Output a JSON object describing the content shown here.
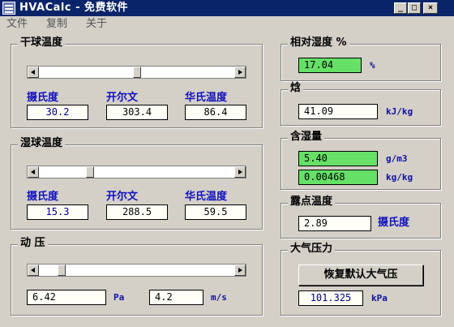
{
  "window": {
    "title": "HVACalc - 免费软件",
    "minimize": "_",
    "maximize": "□",
    "close": "×"
  },
  "menu": {
    "file": "文件",
    "copy": "复制",
    "about": "关于"
  },
  "dry_bulb": {
    "title": "干球温度",
    "celsius_label": "摄氏度",
    "kelvin_label": "开尔文",
    "fahrenheit_label": "华氏温度",
    "celsius": "30.2",
    "kelvin": "303.4",
    "fahrenheit": "86.4",
    "slider_fraction": 0.5
  },
  "wet_bulb": {
    "title": "湿球温度",
    "celsius_label": "摄氏度",
    "kelvin_label": "开尔文",
    "fahrenheit_label": "华氏温度",
    "celsius": "15.3",
    "kelvin": "288.5",
    "fahrenheit": "59.5",
    "slider_fraction": 0.25
  },
  "dynamic_pressure": {
    "title": "动 压",
    "pressure": "6.42",
    "pressure_unit": "Pa",
    "velocity": "4.2",
    "velocity_unit": "m/s",
    "slider_fraction": 0.1
  },
  "relative_humidity": {
    "title": "相对湿度 %",
    "value": "17.04",
    "unit": "%"
  },
  "enthalpy": {
    "title": "焓",
    "value": "41.09",
    "unit": "kJ/kg"
  },
  "moisture": {
    "title": "含湿量",
    "value1": "5.40",
    "unit1": "g/m3",
    "value2": "0.00468",
    "unit2": "kg/kg"
  },
  "dew_point": {
    "title": "露点温度",
    "value": "2.89",
    "unit": "摄氏度"
  },
  "atmospheric": {
    "title": "大气压力",
    "reset_button": "恢复默认大气压",
    "value": "101.325",
    "unit": "kPa"
  },
  "colors": {
    "title_bar": "#0a246a",
    "green_field": "#66e066",
    "label_blue": "#1010c0",
    "window_bg": "#d4d0c8"
  }
}
